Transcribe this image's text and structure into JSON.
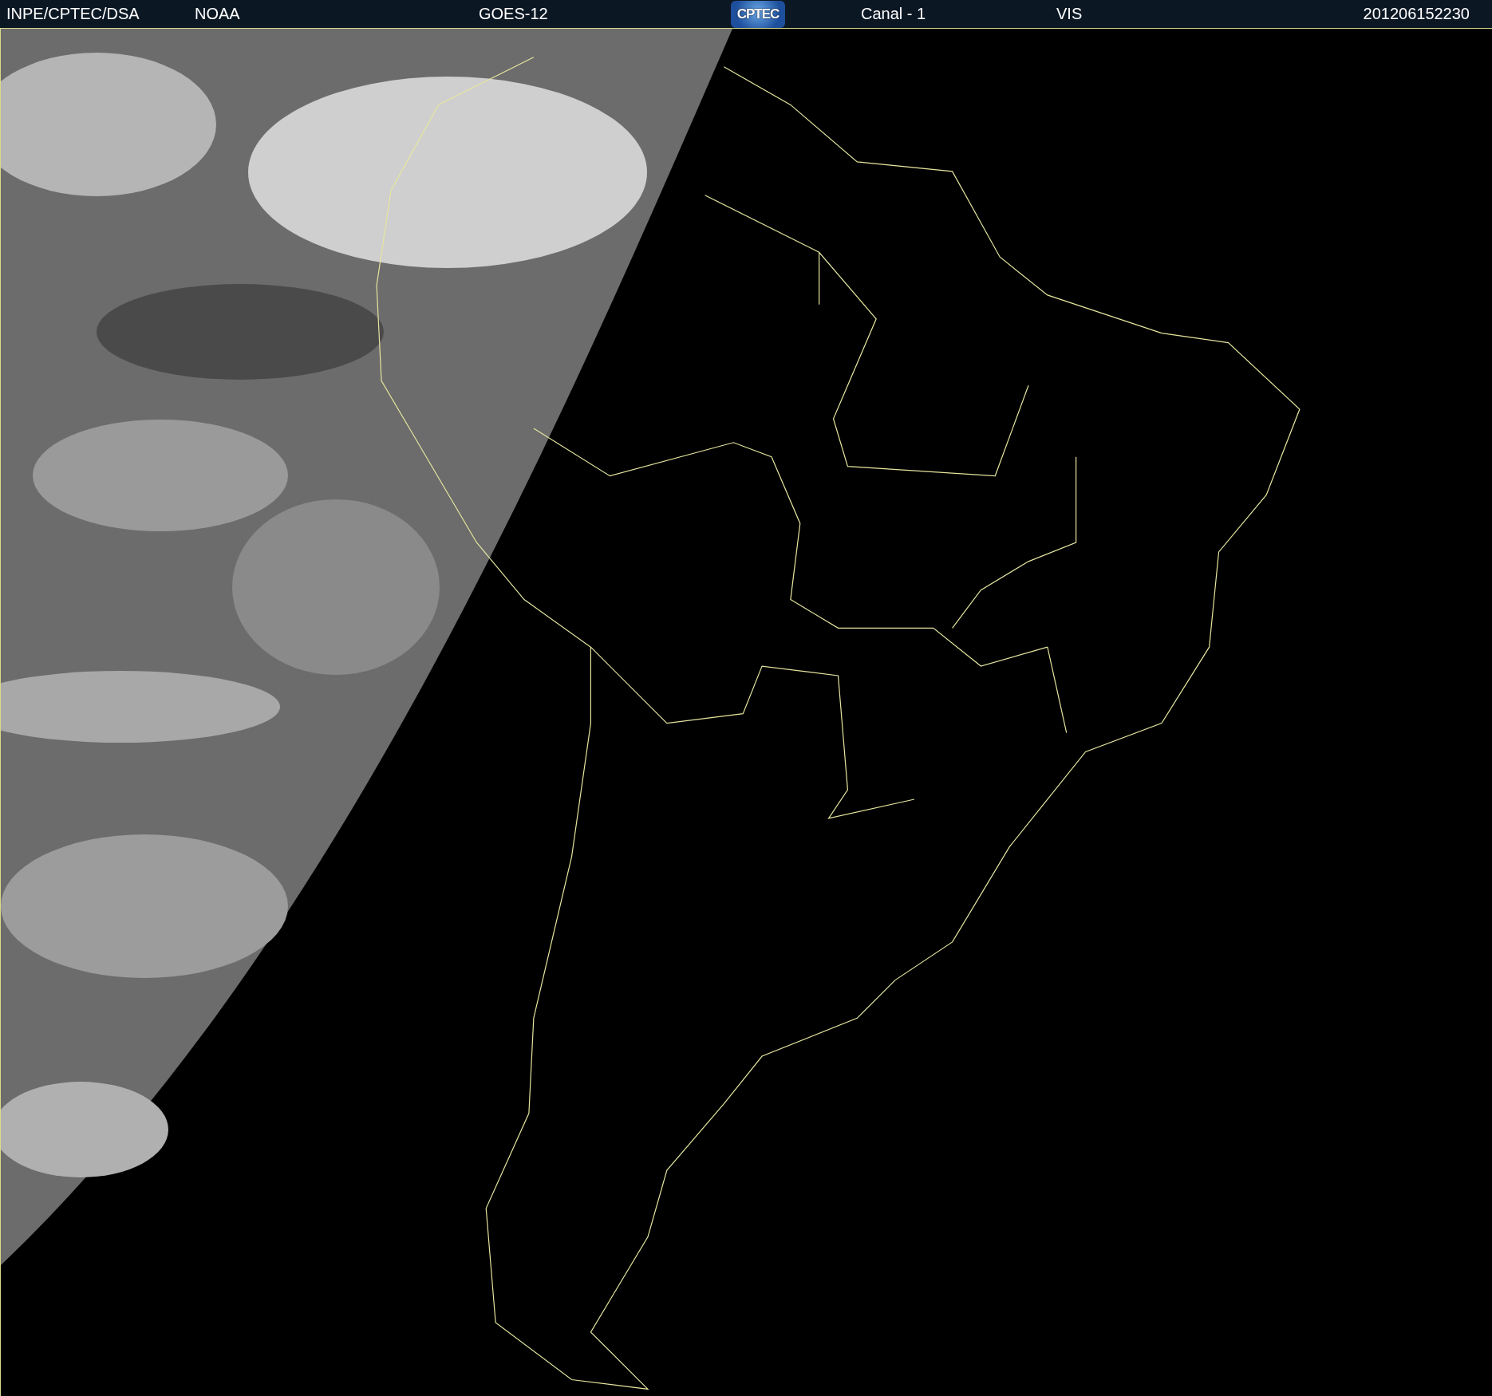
{
  "header": {
    "items": [
      {
        "kind": "text",
        "text": "INPE/CPTEC/DSA"
      },
      {
        "kind": "text",
        "text": "NOAA"
      },
      {
        "kind": "text",
        "text": "GOES-12"
      },
      {
        "kind": "logo",
        "text": "CPTEC"
      },
      {
        "kind": "text",
        "text": "Canal - 1"
      },
      {
        "kind": "text",
        "text": "VIS"
      },
      {
        "kind": "text",
        "text": "201206152230"
      }
    ]
  }
}
